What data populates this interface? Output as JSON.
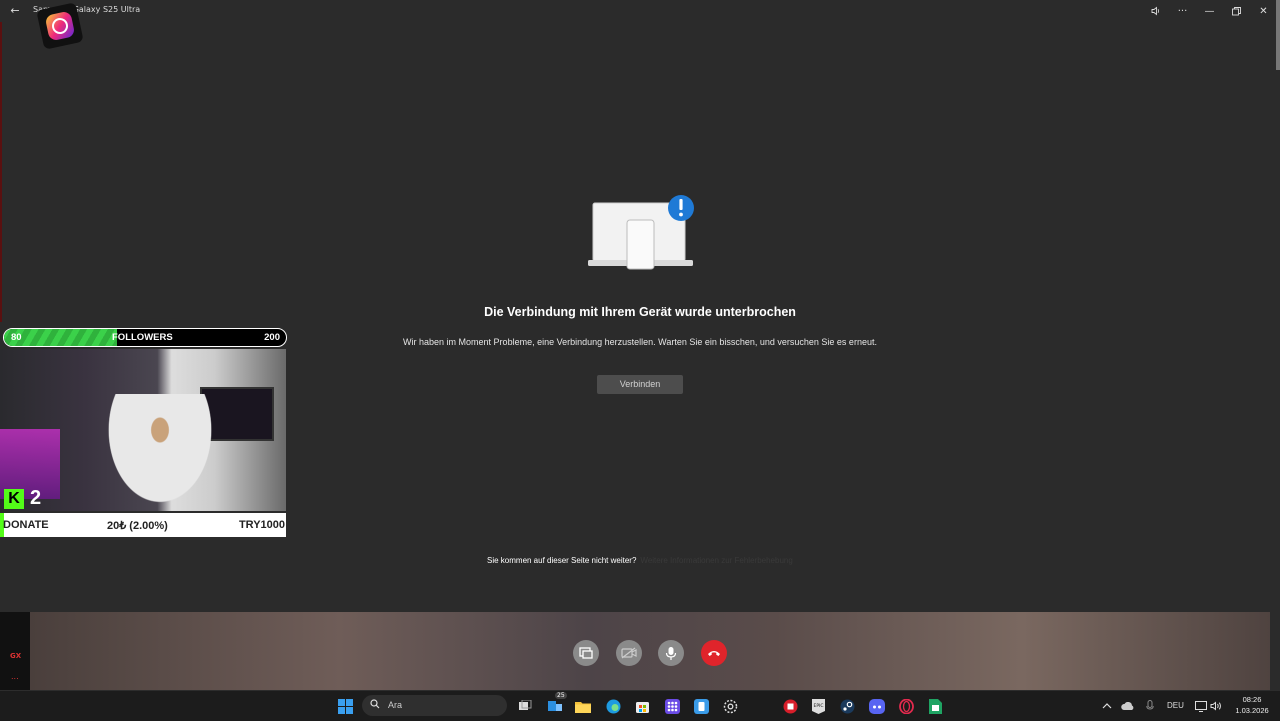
{
  "titlebar": {
    "title": "Samsung Galaxy S25 Ultra"
  },
  "error": {
    "title": "Die Verbindung mit Ihrem Gerät wurde unterbrochen",
    "message": "Wir haben im Moment Probleme, eine Verbindung herzustellen. Warten Sie ein bisschen, und versuchen Sie es erneut.",
    "connect_label": "Verbinden",
    "help_text": "Sie kommen auf dieser Seite nicht weiter?",
    "help_link": "Weitere Informationen zur Fehlerbehebung"
  },
  "overlay": {
    "followers_current": "80",
    "followers_label": "FOLLOWERS",
    "followers_goal": "200",
    "followers_progress": 0.4,
    "kick_count": "2",
    "donate_label": "DONATE",
    "donate_amount": "20₺ (2.00%)",
    "donate_code": "TRY1000"
  },
  "sidebar": {
    "gx_label": "GX",
    "dots": "..."
  },
  "taskbar": {
    "search_placeholder": "Ara",
    "language": "DEU",
    "time": "08:26",
    "date": "1.03.2026",
    "badge": "25"
  },
  "colors": {
    "end_call": "#e0242b",
    "kick_green": "#53fc18",
    "info_blue": "#1f7ad6"
  }
}
